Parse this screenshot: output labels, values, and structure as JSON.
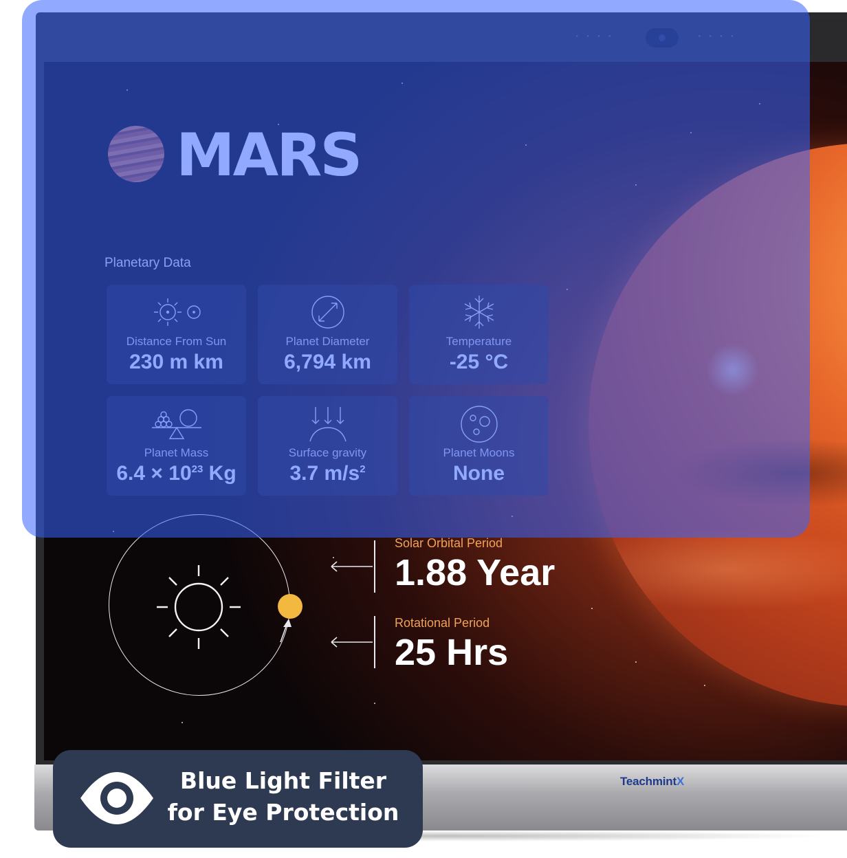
{
  "planet_name": "MARS",
  "section_label": "Planetary Data",
  "cards": [
    {
      "icon": "sun-distance-icon",
      "label": "Distance From Sun",
      "value": "230 m km"
    },
    {
      "icon": "diameter-icon",
      "label": "Planet Diameter",
      "value": "6,794 km"
    },
    {
      "icon": "snowflake-icon",
      "label": "Temperature",
      "value": "-25 °C"
    },
    {
      "icon": "mass-scale-icon",
      "label": "Planet Mass",
      "value_base": "6.4 × 10",
      "value_exp": "23",
      "value_unit": " Kg"
    },
    {
      "icon": "gravity-icon",
      "label": "Surface gravity",
      "value_base": "3.7 m/s",
      "value_exp": "2"
    },
    {
      "icon": "moon-icon",
      "label": "Planet Moons",
      "value": "None"
    }
  ],
  "orbit": {
    "solar_period_label": "Solar Orbital Period",
    "solar_period_value": "1.88 Year",
    "rotational_period_label": "Rotational Period",
    "rotational_period_value": "25 Hrs"
  },
  "badge": {
    "line1": "Blue Light Filter",
    "line2": "for Eye Protection"
  },
  "brand": {
    "name": "Teachmint",
    "suffix": "X"
  },
  "colors": {
    "filter_overlay": "#3764ff",
    "badge_bg": "#2e3a52",
    "accent_orange": "#f0a25a",
    "orbit_planet": "#f3b840"
  }
}
